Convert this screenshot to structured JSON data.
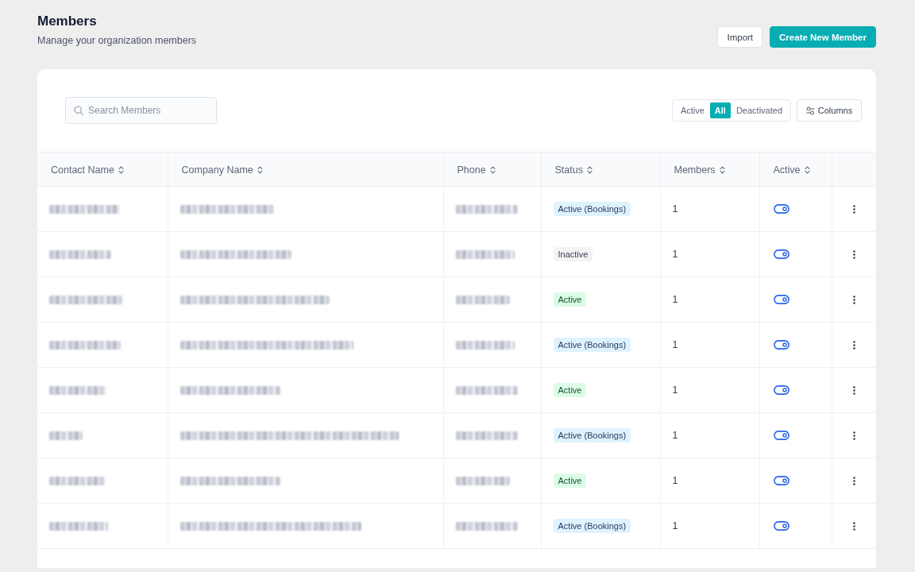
{
  "header": {
    "title": "Members",
    "subtitle": "Manage your organization members",
    "buttons": [
      {
        "label": "Import",
        "kind": "secondary"
      },
      {
        "label": "Create New Member",
        "kind": "primary"
      }
    ]
  },
  "toolbar": {
    "search": {
      "placeholder": "Search Members"
    },
    "filter": [
      {
        "label": "Active",
        "selected": false
      },
      {
        "label": "All",
        "selected": true
      },
      {
        "label": "Deactivated",
        "selected": false
      }
    ],
    "columns_button": {
      "label": "Columns"
    }
  },
  "table": {
    "columns": [
      {
        "label": "Contact Name",
        "sortable": true
      },
      {
        "label": "Company Name",
        "sortable": true
      },
      {
        "label": "Phone",
        "sortable": true
      },
      {
        "label": "Status",
        "sortable": true
      },
      {
        "label": "Members",
        "sortable": true
      },
      {
        "label": "Active",
        "sortable": true
      }
    ],
    "rows": [
      {
        "status": {
          "label": "Active (Bookings)",
          "kind": "bookings"
        },
        "members": "1",
        "on": true
      },
      {
        "status": {
          "label": "Inactive",
          "kind": "inactive"
        },
        "members": "1",
        "on": true
      },
      {
        "status": {
          "label": "Active",
          "kind": "active"
        },
        "members": "1",
        "on": true
      },
      {
        "status": {
          "label": "Active (Bookings)",
          "kind": "bookings"
        },
        "members": "1",
        "on": true
      },
      {
        "status": {
          "label": "Active",
          "kind": "active"
        },
        "members": "1",
        "on": true
      },
      {
        "status": {
          "label": "Active (Bookings)",
          "kind": "bookings"
        },
        "members": "1",
        "on": true
      },
      {
        "status": {
          "label": "Active",
          "kind": "active"
        },
        "members": "1",
        "on": true
      },
      {
        "status": {
          "label": "Active (Bookings)",
          "kind": "bookings"
        },
        "members": "1",
        "on": true
      }
    ]
  }
}
